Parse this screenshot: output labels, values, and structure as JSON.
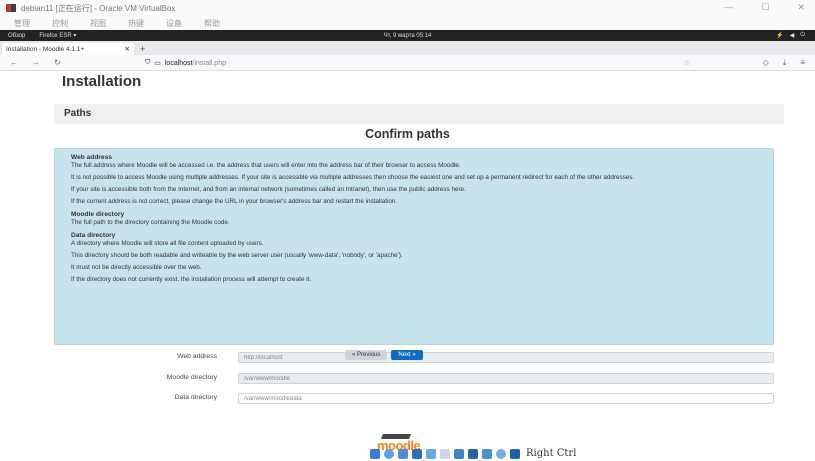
{
  "vbox": {
    "title": "debian11 [正在运行] - Oracle VM VirtualBox",
    "menu": [
      "管理",
      "控制",
      "视图",
      "热键",
      "设备",
      "帮助"
    ],
    "win_minimize": "—",
    "win_maximize": "☐",
    "win_close": "✕",
    "host_key": "Right Ctrl"
  },
  "guest_panel": {
    "activities": "Обзор",
    "app": "Firefox ESR ▾",
    "clock": "Чт, 9 марта 05:14"
  },
  "firefox": {
    "tab_title": "Installation - Moodle 4.1.1+",
    "tab_close": "✕",
    "new_tab": "+",
    "url_host": "localhost",
    "url_path": "/install.php"
  },
  "page": {
    "title": "Installation",
    "section": "Paths",
    "confirm_heading": "Confirm paths",
    "web_address": {
      "heading": "Web address",
      "p1": "The full address where Moodle will be accessed i.e. the address that users will enter into the address bar of their browser to access Moodle.",
      "p2": "It is not possible to access Moodle using multiple addresses. If your site is accessible via multiple addresses then choose the easiest one and set up a permanent redirect for each of the other addresses.",
      "p3": "If your site is accessible both from the Internet, and from an internal network (sometimes called an Intranet), then use the public address here.",
      "p4": "If the current address is not correct, please change the URL in your browser's address bar and restart the installation."
    },
    "moodle_dir": {
      "heading": "Moodle directory",
      "p1": "The full path to the directory containing the Moodle code."
    },
    "data_dir": {
      "heading": "Data directory",
      "p1": "A directory where Moodle will store all file content uploaded by users.",
      "p2": "This directory should be both readable and writeable by the web server user (usually 'www-data', 'nobody', or 'apache').",
      "p3": "It must not be directly accessible over the web.",
      "p4": "If the directory does not currently exist, the installation process will attempt to create it."
    },
    "form": {
      "web_address_label": "Web address",
      "web_address_value": "http://localhost",
      "moodle_dir_label": "Moodle directory",
      "moodle_dir_value": "/var/www/moodle",
      "data_dir_label": "Data directory",
      "data_dir_value": "/var/www/moodledata"
    },
    "prev_button": "« Previous",
    "next_button": "Next »",
    "logo": "moodle"
  }
}
